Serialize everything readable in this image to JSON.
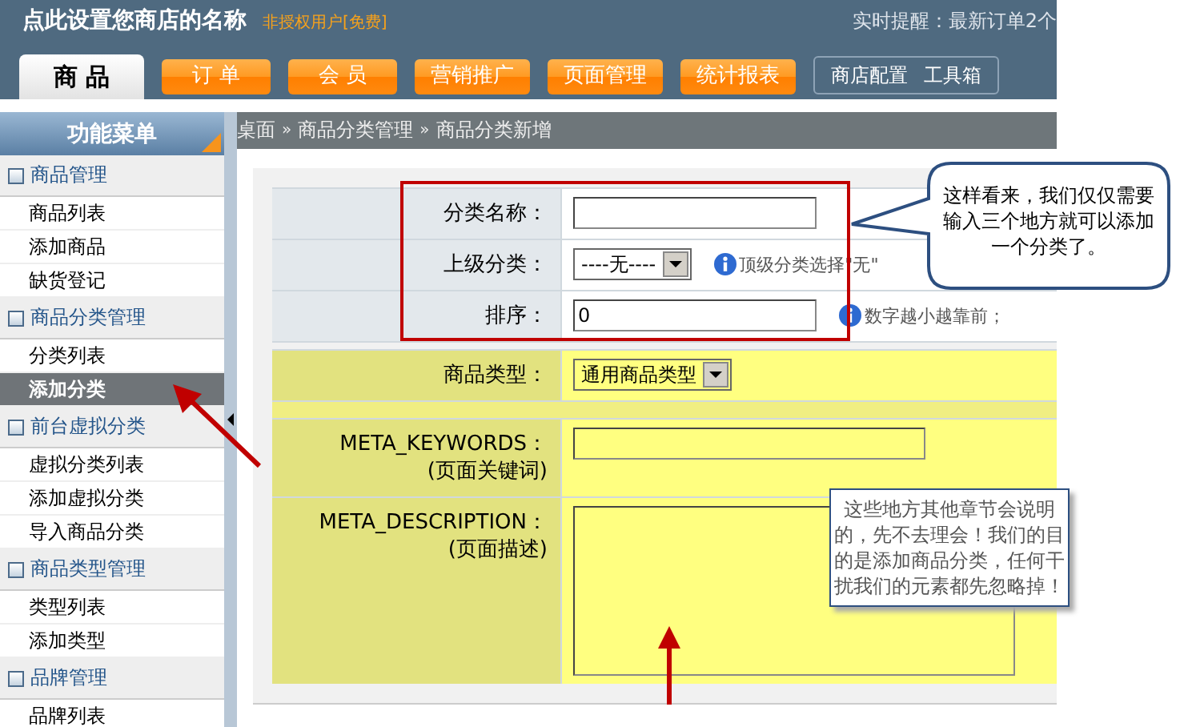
{
  "header": {
    "store_name": "点此设置您商店的名称",
    "license": "非授权用户[免费]",
    "notice": "实时提醒：最新订单2个"
  },
  "tabs": [
    {
      "label": "商 品",
      "selected": true
    },
    {
      "label": "订 单",
      "selected": false
    },
    {
      "label": "会 员",
      "selected": false
    },
    {
      "label": "营销推广",
      "selected": false
    },
    {
      "label": "页面管理",
      "selected": false
    },
    {
      "label": "统计报表",
      "selected": false
    }
  ],
  "toolbox": [
    "商店配置",
    "工具箱"
  ],
  "sidebar": {
    "title": "功能菜单",
    "groups": [
      {
        "label": "商品管理",
        "items": [
          {
            "label": "商品列表",
            "selected": false
          },
          {
            "label": "添加商品",
            "selected": false
          },
          {
            "label": "缺货登记",
            "selected": false
          }
        ]
      },
      {
        "label": "商品分类管理",
        "items": [
          {
            "label": "分类列表",
            "selected": false
          },
          {
            "label": "添加分类",
            "selected": true
          }
        ]
      },
      {
        "label": "前台虚拟分类",
        "items": [
          {
            "label": "虚拟分类列表",
            "selected": false
          },
          {
            "label": "添加虚拟分类",
            "selected": false
          },
          {
            "label": "导入商品分类",
            "selected": false
          }
        ]
      },
      {
        "label": "商品类型管理",
        "items": [
          {
            "label": "类型列表",
            "selected": false
          },
          {
            "label": "添加类型",
            "selected": false
          }
        ]
      },
      {
        "label": "品牌管理",
        "items": [
          {
            "label": "品牌列表",
            "selected": false
          }
        ]
      }
    ]
  },
  "breadcrumb": {
    "separator": "»",
    "items": [
      "桌面",
      "商品分类管理",
      "商品分类新增"
    ]
  },
  "form": {
    "rows": [
      {
        "kind": "text",
        "label": "分类名称：",
        "highlighted": false
      },
      {
        "kind": "select",
        "label": "上级分类：",
        "value": "----无----",
        "hint": "顶级分类选择\"无\"",
        "highlighted": false
      },
      {
        "kind": "text",
        "label": "排序：",
        "value": "0",
        "hint": "数字越小越靠前；",
        "highlighted": false
      },
      {
        "kind": "spacer",
        "highlighted": false
      },
      {
        "kind": "select",
        "label": "商品类型：",
        "value": "通用商品类型",
        "highlighted": true
      },
      {
        "kind": "spacer",
        "highlighted": true
      },
      {
        "kind": "text",
        "label": "META_KEYWORDS：",
        "sublabel": "(页面关键词)",
        "highlighted": true
      },
      {
        "kind": "textarea",
        "label": "META_DESCRIPTION：",
        "sublabel": "(页面描述)",
        "highlighted": true
      }
    ]
  },
  "annotations": {
    "callout": "这样看来，我们仅仅需要输入三个地方就可以添加一个分类了。",
    "note": "这些地方其他章节会说明的，先不去理会！我们的目的是添加商品分类，任何干扰我们的元素都先忽略掉！"
  }
}
